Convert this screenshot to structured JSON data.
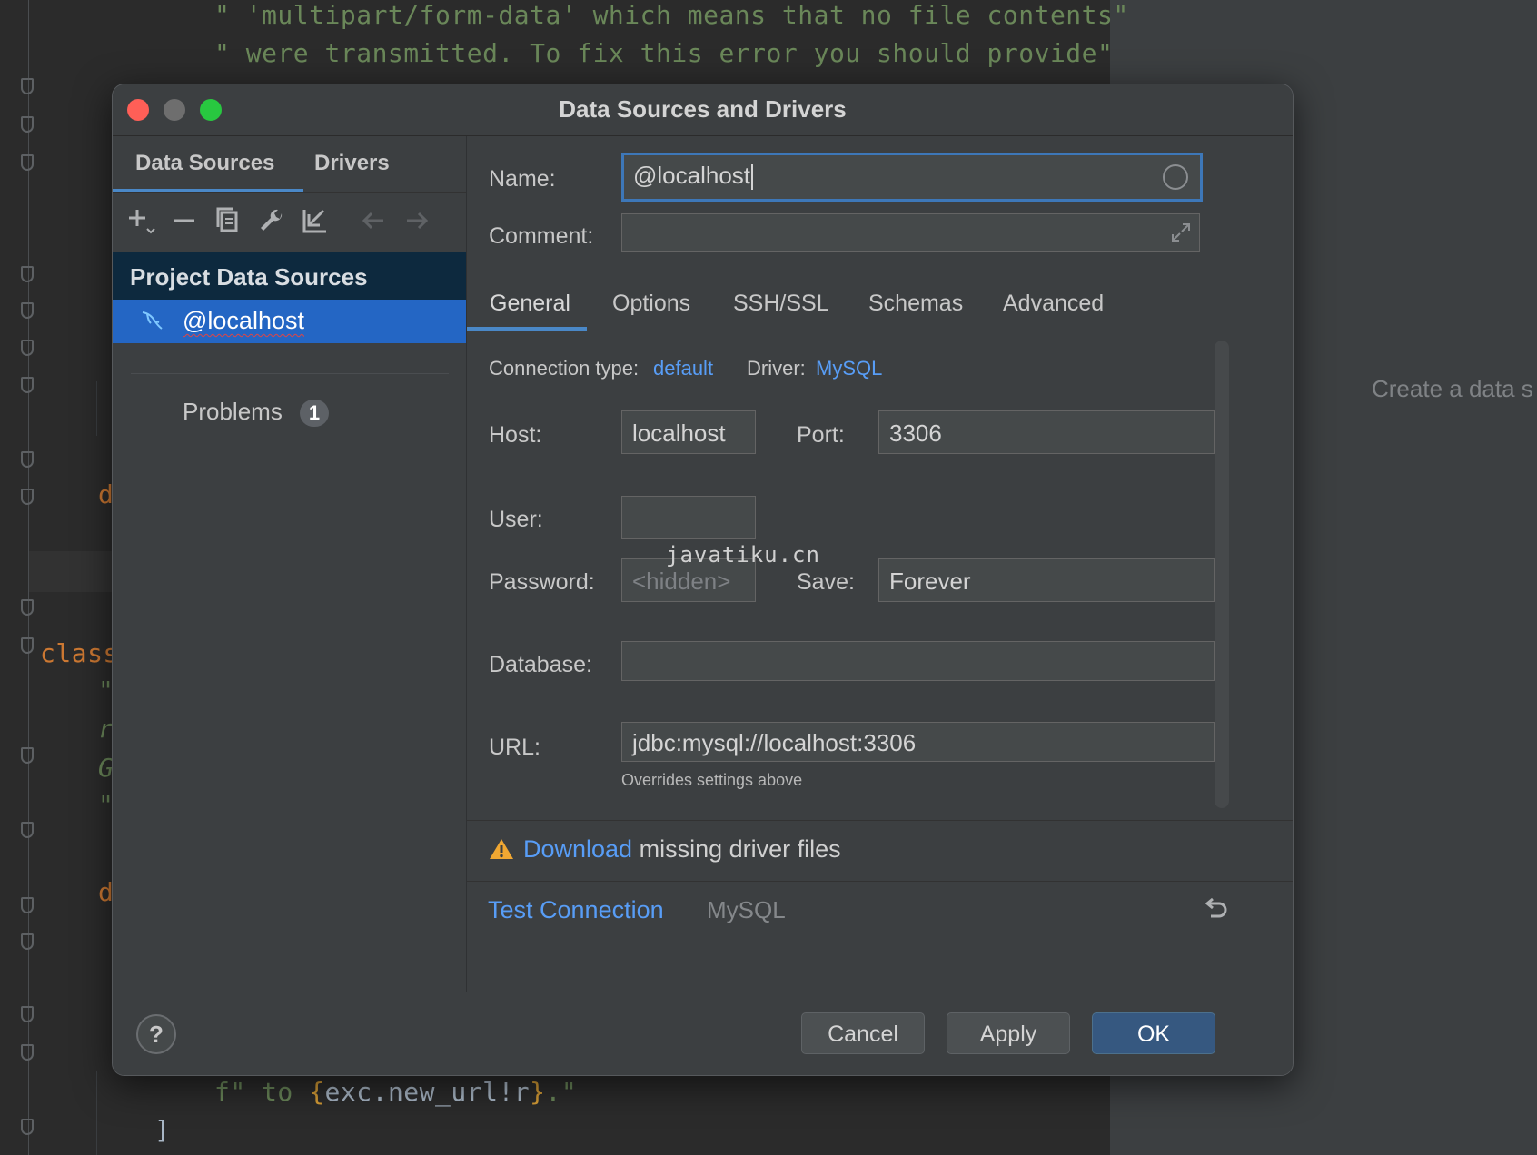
{
  "editor": {
    "lines_top": [
      "\" 'multipart/form-data' which means that no file contents\"",
      "\" were transmitted. To fix this error you should provide\""
    ],
    "side_snippets": {
      "d1": "d",
      "class_kw": "class",
      "q1": "\"",
      "r1": "r",
      "g1": "G",
      "q2": "\"",
      "d2": "d"
    },
    "bottom_line_prefix": "f\" to ",
    "bottom_line_brace_open": "{",
    "bottom_line_expr": "exc.new_url!r",
    "bottom_line_brace_close": "}",
    "bottom_line_suffix": ".\"",
    "bracket": "]",
    "right_hint": "Create a data s"
  },
  "dialog": {
    "title": "Data Sources and Drivers",
    "left": {
      "tabs": [
        "Data Sources",
        "Drivers"
      ],
      "toolbar_icons": [
        "add-icon",
        "remove-icon",
        "copy-icon",
        "wrench-icon",
        "import-icon",
        "back-arrow-icon",
        "forward-arrow-icon"
      ],
      "section": "Project Data Sources",
      "selected_item": "@localhost",
      "problems_label": "Problems",
      "problems_count": "1"
    },
    "right": {
      "name_label": "Name:",
      "name_value": "@localhost",
      "comment_label": "Comment:",
      "tabs": [
        "General",
        "Options",
        "SSH/SSL",
        "Schemas",
        "Advanced"
      ],
      "connection_type_label": "Connection type:",
      "connection_type_value": "default",
      "driver_label": "Driver:",
      "driver_value": "MySQL",
      "host_label": "Host:",
      "host_value": "localhost",
      "port_label": "Port:",
      "port_value": "3306",
      "user_label": "User:",
      "user_value": "",
      "password_label": "Password:",
      "password_placeholder": "<hidden>",
      "save_label": "Save:",
      "save_value": "Forever",
      "database_label": "Database:",
      "database_value": "",
      "url_label": "URL:",
      "url_value": "jdbc:mysql://localhost:3306",
      "url_note": "Overrides settings above",
      "warning_link": "Download",
      "warning_text": " missing driver files",
      "test_connection": "Test Connection",
      "test_driver": "MySQL"
    },
    "footer": {
      "help": "?",
      "cancel": "Cancel",
      "apply": "Apply",
      "ok": "OK"
    }
  },
  "watermark": "javatiku.cn",
  "colors": {
    "accent": "#4a88c7",
    "link": "#589df6",
    "selection": "#2466c4",
    "primary_button": "#365880"
  }
}
